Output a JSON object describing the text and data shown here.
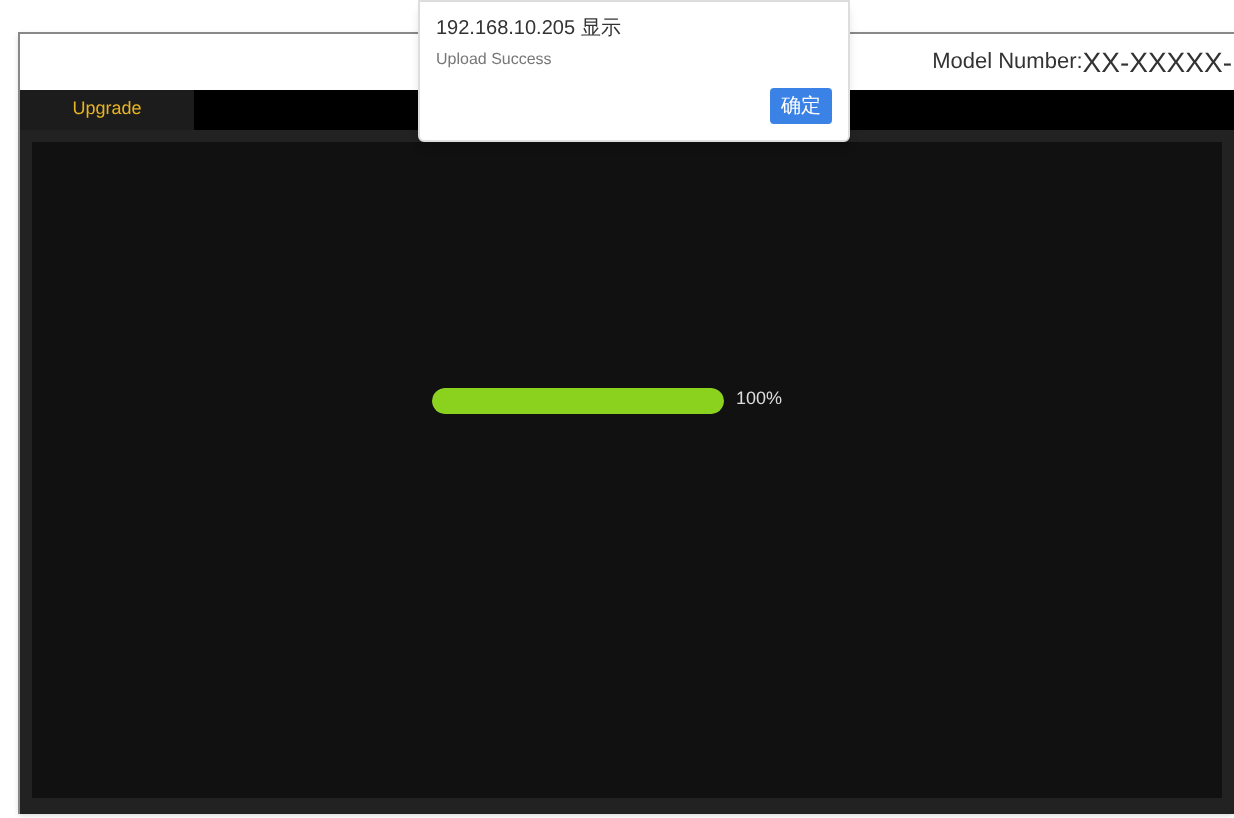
{
  "header": {
    "model_label": "Model Number:",
    "model_value": "XX-XXXXX-"
  },
  "nav": {
    "tabs": [
      {
        "label": "Upgrade",
        "selected": true
      }
    ]
  },
  "progress": {
    "level": 1,
    "reading": "100%"
  },
  "dialog": {
    "title": "192.168.10.205 显示",
    "message": "Upload Success",
    "button": "确定"
  }
}
